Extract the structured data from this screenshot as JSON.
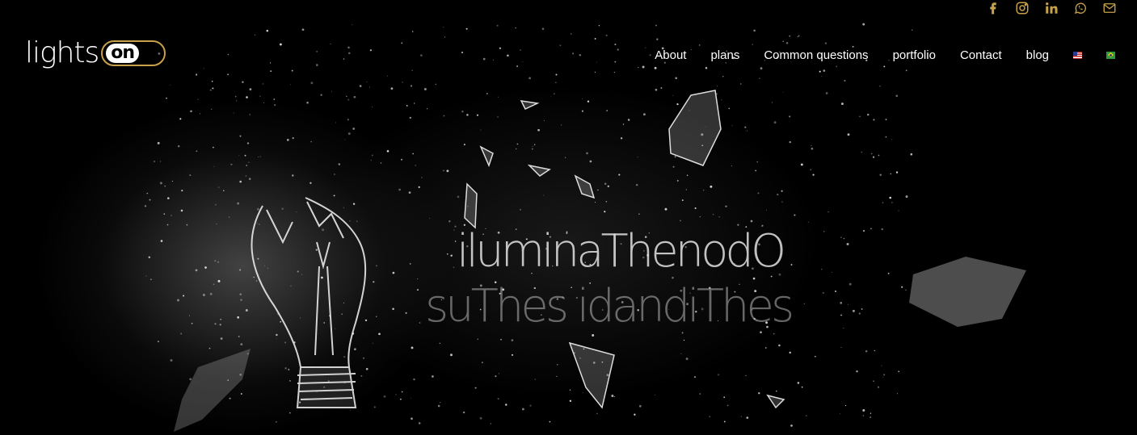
{
  "header": {
    "logo": {
      "text": "lights",
      "pill_text": "on"
    },
    "social": [
      {
        "icon": "facebook-icon",
        "color": "#c8a14a"
      },
      {
        "icon": "instagram-icon",
        "color": "#c8a14a"
      },
      {
        "icon": "linkedin-icon",
        "color": "#c8a14a"
      },
      {
        "icon": "whatsapp-icon",
        "color": "#c8a14a"
      },
      {
        "icon": "mail-icon",
        "color": "#c8a14a"
      }
    ],
    "nav": {
      "about": "About",
      "plans": "plans",
      "faq": "Common questions",
      "portfolio": "portfolio",
      "contact": "Contact",
      "blog": "blog"
    },
    "languages": [
      "en-us-flag",
      "pt-br-flag"
    ]
  },
  "hero": {
    "line1": "iluminaThenodO",
    "line2": "suThes idandiThes"
  },
  "colors": {
    "accent": "#c8a14a",
    "background": "#000000",
    "text": "#ffffff"
  }
}
